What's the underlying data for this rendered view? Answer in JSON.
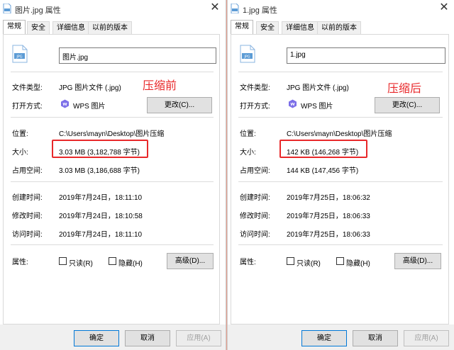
{
  "left": {
    "title": "图片.jpg 属性",
    "tabs": [
      "常规",
      "安全",
      "详细信息",
      "以前的版本"
    ],
    "filename": "图片.jpg",
    "annotation": "压缩前",
    "rows": {
      "type_label": "文件类型:",
      "type_value": "JPG 图片文件 (.jpg)",
      "open_label": "打开方式:",
      "open_value": "WPS 图片",
      "change_button": "更改(C)...",
      "location_label": "位置:",
      "location_value": "C:\\Users\\mayn\\Desktop\\图片压缩",
      "size_label": "大小:",
      "size_value": "3.03 MB (3,182,788 字节)",
      "disk_label": "占用空间:",
      "disk_value": "3.03 MB (3,186,688 字节)",
      "created_label": "创建时间:",
      "created_value": "2019年7月24日，18:11:10",
      "modified_label": "修改时间:",
      "modified_value": "2019年7月24日，18:10:58",
      "accessed_label": "访问时间:",
      "accessed_value": "2019年7月24日，18:11:10",
      "attr_label": "属性:",
      "readonly": "只读(R)",
      "hidden": "隐藏(H)",
      "advanced_button": "高级(D)..."
    },
    "footer": {
      "ok": "确定",
      "cancel": "取消",
      "apply": "应用(A)"
    }
  },
  "right": {
    "title": "1.jpg 属性",
    "tabs": [
      "常规",
      "安全",
      "详细信息",
      "以前的版本"
    ],
    "filename": "1.jpg",
    "annotation": "压缩后",
    "rows": {
      "type_label": "文件类型:",
      "type_value": "JPG 图片文件 (.jpg)",
      "open_label": "打开方式:",
      "open_value": "WPS 图片",
      "change_button": "更改(C)...",
      "location_label": "位置:",
      "location_value": "C:\\Users\\mayn\\Desktop\\图片压缩",
      "size_label": "大小:",
      "size_value": "142 KB (146,268 字节)",
      "disk_label": "占用空间:",
      "disk_value": "144 KB (147,456 字节)",
      "created_label": "创建时间:",
      "created_value": "2019年7月25日，18:06:32",
      "modified_label": "修改时间:",
      "modified_value": "2019年7月25日，18:06:33",
      "accessed_label": "访问时间:",
      "accessed_value": "2019年7月25日，18:06:33",
      "attr_label": "属性:",
      "readonly": "只读(R)",
      "hidden": "隐藏(H)",
      "advanced_button": "高级(D)..."
    },
    "footer": {
      "ok": "确定",
      "cancel": "取消",
      "apply": "应用(A)"
    }
  },
  "colors": {
    "annotation": "#e8282a",
    "accent": "#0078d7"
  },
  "icons": {
    "file": "jpg-file-icon",
    "wps": "wps-icon",
    "close": "close-icon"
  }
}
